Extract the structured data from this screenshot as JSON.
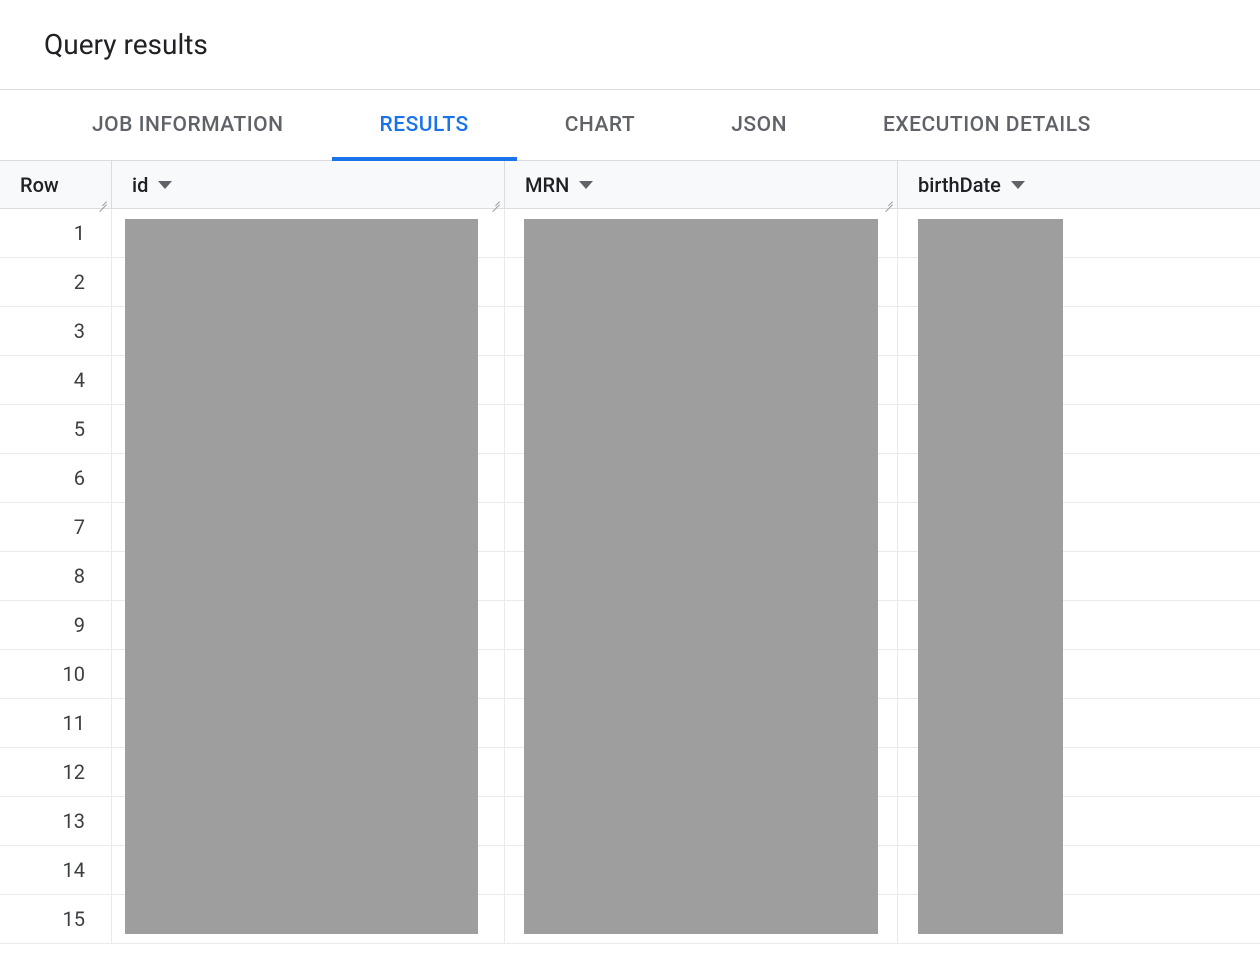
{
  "header": {
    "title": "Query results"
  },
  "tabs": [
    {
      "label": "JOB INFORMATION",
      "active": false
    },
    {
      "label": "RESULTS",
      "active": true
    },
    {
      "label": "CHART",
      "active": false
    },
    {
      "label": "JSON",
      "active": false
    },
    {
      "label": "EXECUTION DETAILS",
      "active": false
    }
  ],
  "columns": {
    "row": {
      "label": "Row"
    },
    "id": {
      "label": "id"
    },
    "mrn": {
      "label": "MRN"
    },
    "bd": {
      "label": "birthDate"
    }
  },
  "rows": [
    {
      "n": "1"
    },
    {
      "n": "2"
    },
    {
      "n": "3"
    },
    {
      "n": "4"
    },
    {
      "n": "5"
    },
    {
      "n": "6"
    },
    {
      "n": "7"
    },
    {
      "n": "8"
    },
    {
      "n": "9"
    },
    {
      "n": "10"
    },
    {
      "n": "11"
    },
    {
      "n": "12"
    },
    {
      "n": "13"
    },
    {
      "n": "14"
    },
    {
      "n": "15"
    }
  ]
}
